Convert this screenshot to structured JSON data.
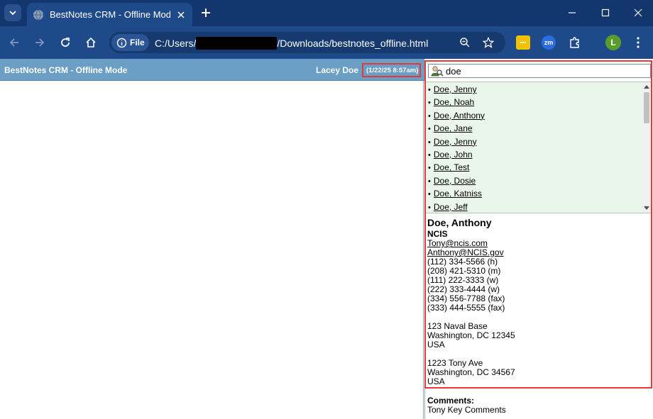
{
  "browser": {
    "tab_title": "BestNotes CRM - Offline Mode",
    "address_chip": "File",
    "url_prefix": "C:/Users/",
    "url_suffix": "/Downloads/bestnotes_offline.html",
    "profile_initial": "L",
    "zoom_ext_label": "zm",
    "accent_color": "#1f4a8a"
  },
  "app": {
    "title": "BestNotes CRM - Offline Mode",
    "user": "Lacey Doe",
    "timestamp": "(1/22/25 8:57am)"
  },
  "search": {
    "value": "doe"
  },
  "results": [
    "Doe, Jenny",
    "Doe, Noah",
    "Doe, Anthony",
    "Doe, Jane",
    "Doe, Jenny",
    "Doe, John",
    "Doe, Test",
    "Doe, Dosie",
    "Doe, Katniss",
    "Doe, Jeff"
  ],
  "contact": {
    "name": "Doe, Anthony",
    "company": "NCIS",
    "emails": [
      "Tony@ncis.com",
      "Anthony@NCIS.gov"
    ],
    "phones": [
      "(112) 334-5566 (h)",
      "(208) 421-5310 (m)",
      "(111) 222-3333 (w)",
      "(222) 333-4444 (w)",
      "(334) 556-7788 (fax)",
      "(333) 444-5555 (fax)"
    ],
    "addresses": [
      [
        "123 Naval Base",
        "Washington, DC 12345",
        "USA"
      ],
      [
        "1223 Tony Ave",
        "Washington, DC 34567",
        "USA"
      ]
    ],
    "comments_label": "Comments:",
    "comments": "Tony Key Comments"
  }
}
